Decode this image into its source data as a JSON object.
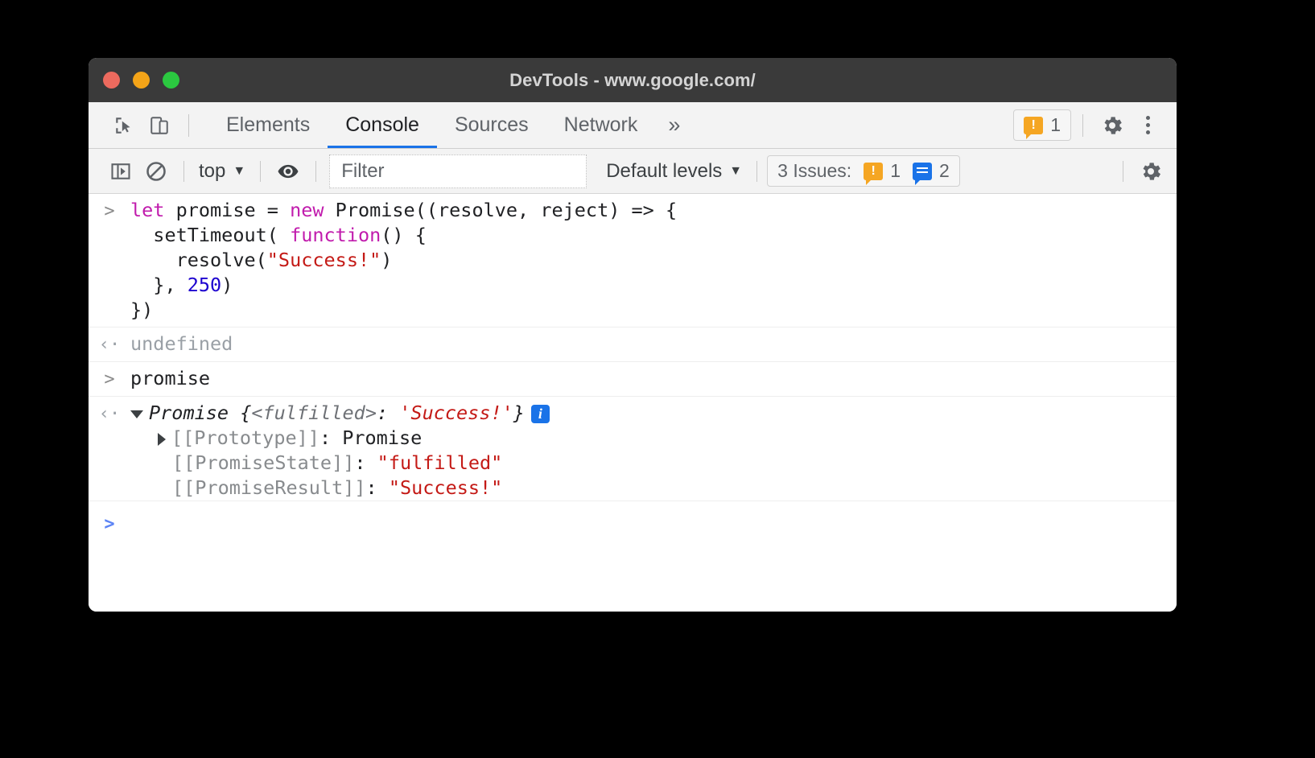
{
  "window": {
    "title": "DevTools - www.google.com/",
    "controls": [
      "close",
      "minimize",
      "maximize"
    ]
  },
  "tabbar": {
    "inspect_icon": "inspect-element-icon",
    "device_icon": "device-toolbar-icon",
    "tabs": [
      {
        "label": "Elements",
        "active": false
      },
      {
        "label": "Console",
        "active": true
      },
      {
        "label": "Sources",
        "active": false
      },
      {
        "label": "Network",
        "active": false
      }
    ],
    "more_tabs_label": "»",
    "warning_chip": {
      "icon": "warning-icon",
      "count": "1"
    },
    "settings_icon": "gear-icon",
    "more_options_icon": "kebab-menu-icon"
  },
  "console_toolbar": {
    "sidebar_toggle_icon": "console-sidebar-icon",
    "clear_icon": "clear-console-icon",
    "context_label": "top",
    "context_caret": "▼",
    "eye_icon": "live-expression-icon",
    "filter_placeholder": "Filter",
    "filter_value": "",
    "levels_label": "Default levels",
    "levels_caret": "▼",
    "issues": {
      "label": "3 Issues:",
      "warning_icon": "warning-icon",
      "warning_count": "1",
      "info_icon": "info-icon",
      "info_count": "2"
    },
    "settings_icon": "gear-icon"
  },
  "console": {
    "input_marker": ">",
    "output_marker": "‹·",
    "entries": [
      {
        "type": "input",
        "lines": [
          [
            {
              "t": "let ",
              "c": "kw"
            },
            {
              "t": "promise = ",
              "c": "plain"
            },
            {
              "t": "new ",
              "c": "kw"
            },
            {
              "t": "Promise((resolve, reject) => {",
              "c": "plain"
            }
          ],
          [
            {
              "t": "  setTimeout( ",
              "c": "plain"
            },
            {
              "t": "function",
              "c": "kw"
            },
            {
              "t": "() {",
              "c": "plain"
            }
          ],
          [
            {
              "t": "    resolve(",
              "c": "plain"
            },
            {
              "t": "\"Success!\"",
              "c": "str"
            },
            {
              "t": ")",
              "c": "plain"
            }
          ],
          [
            {
              "t": "  }, ",
              "c": "plain"
            },
            {
              "t": "250",
              "c": "num"
            },
            {
              "t": ")",
              "c": "plain"
            }
          ],
          [
            {
              "t": "})",
              "c": "plain"
            }
          ]
        ]
      },
      {
        "type": "output",
        "text": "undefined"
      },
      {
        "type": "input",
        "lines": [
          [
            {
              "t": "promise",
              "c": "plain"
            }
          ]
        ]
      },
      {
        "type": "object",
        "header": {
          "triangle": "down",
          "name": "Promise ",
          "brace_open": "{",
          "state": "<fulfilled>",
          "colon": ": ",
          "value": "'Success!'",
          "brace_close": "}",
          "badge": "i"
        },
        "properties": [
          {
            "triangle": "right",
            "key": "[[Prototype]]",
            "sep": ": ",
            "value": "Promise",
            "value_kind": "plain"
          },
          {
            "triangle": "none",
            "key": "[[PromiseState]]",
            "sep": ": ",
            "value": "\"fulfilled\"",
            "value_kind": "string"
          },
          {
            "triangle": "none",
            "key": "[[PromiseResult]]",
            "sep": ": ",
            "value": "\"Success!\"",
            "value_kind": "string"
          }
        ]
      }
    ],
    "prompt_marker": ">"
  },
  "colors": {
    "accent_blue": "#1a73e8",
    "warning_orange": "#f5a623",
    "string_red": "#c41a16",
    "keyword_magenta": "#c11cad",
    "number_blue": "#1c00cf",
    "titlebar": "#3a3a3a",
    "toolbar_bg": "#f3f3f3"
  }
}
